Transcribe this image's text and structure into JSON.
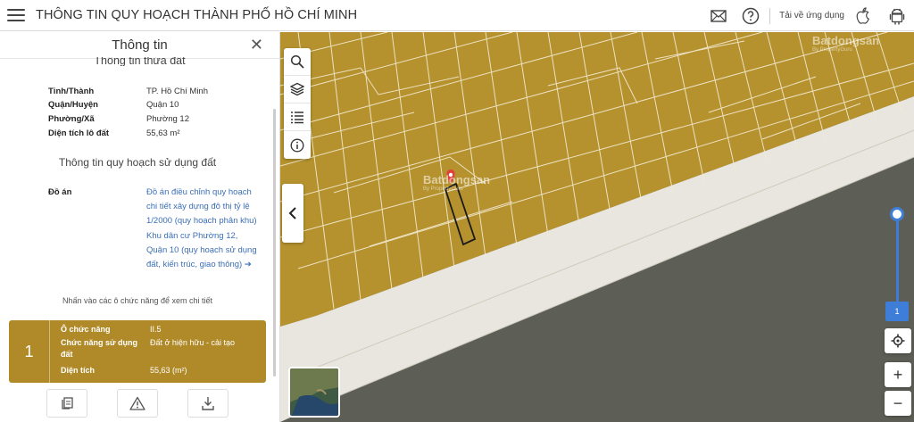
{
  "header": {
    "title": "THÔNG TIN QUY HOẠCH THÀNH PHỐ HỒ CHÍ MINH",
    "download_label": "Tải về ứng dụng"
  },
  "panel": {
    "title": "Thông tin",
    "parcel_section_title": "Thông tin thửa đất",
    "parcel_info": [
      {
        "label": "Tỉnh/Thành",
        "value": "TP. Hồ Chí Minh"
      },
      {
        "label": "Quận/Huyện",
        "value": "Quận 10"
      },
      {
        "label": "Phường/Xã",
        "value": "Phường 12"
      },
      {
        "label": "Diện tích lô đất",
        "value": "55,63 m²"
      }
    ],
    "planning_section_title": "Thông tin quy hoạch sử dụng đất",
    "project": {
      "label": "Đồ án",
      "value": "Đồ án điều chỉnh quy hoạch chi tiết xây dựng đô thị tỷ lệ 1/2000 (quy hoạch phân khu) Khu dân cư Phường 12, Quận 10 (quy hoạch sử dụng đất, kiến trúc, giao thông) ➔"
    },
    "hint": "Nhấn vào các ô chức năng để xem chi tiết",
    "function_card": {
      "number": "1",
      "rows": [
        {
          "label": "Ô chức năng",
          "value": "II.5"
        },
        {
          "label": "Chức năng sử dụng đất",
          "value": "Đất ở hiện hữu - cải tạo"
        },
        {
          "label": "Diện tích",
          "value": "55,63 (m²)"
        }
      ]
    }
  },
  "map": {
    "watermark_brand": "Batdongsan",
    "watermark_sub": "By PropertyGuru",
    "zoom_level": "1",
    "zoom_in": "+",
    "zoom_out": "−",
    "colors": {
      "residential": "#b5922e",
      "road": "#e8e6de",
      "water": "#5d5f56",
      "accent": "#3f7ed8",
      "card": "#b08a28"
    }
  }
}
